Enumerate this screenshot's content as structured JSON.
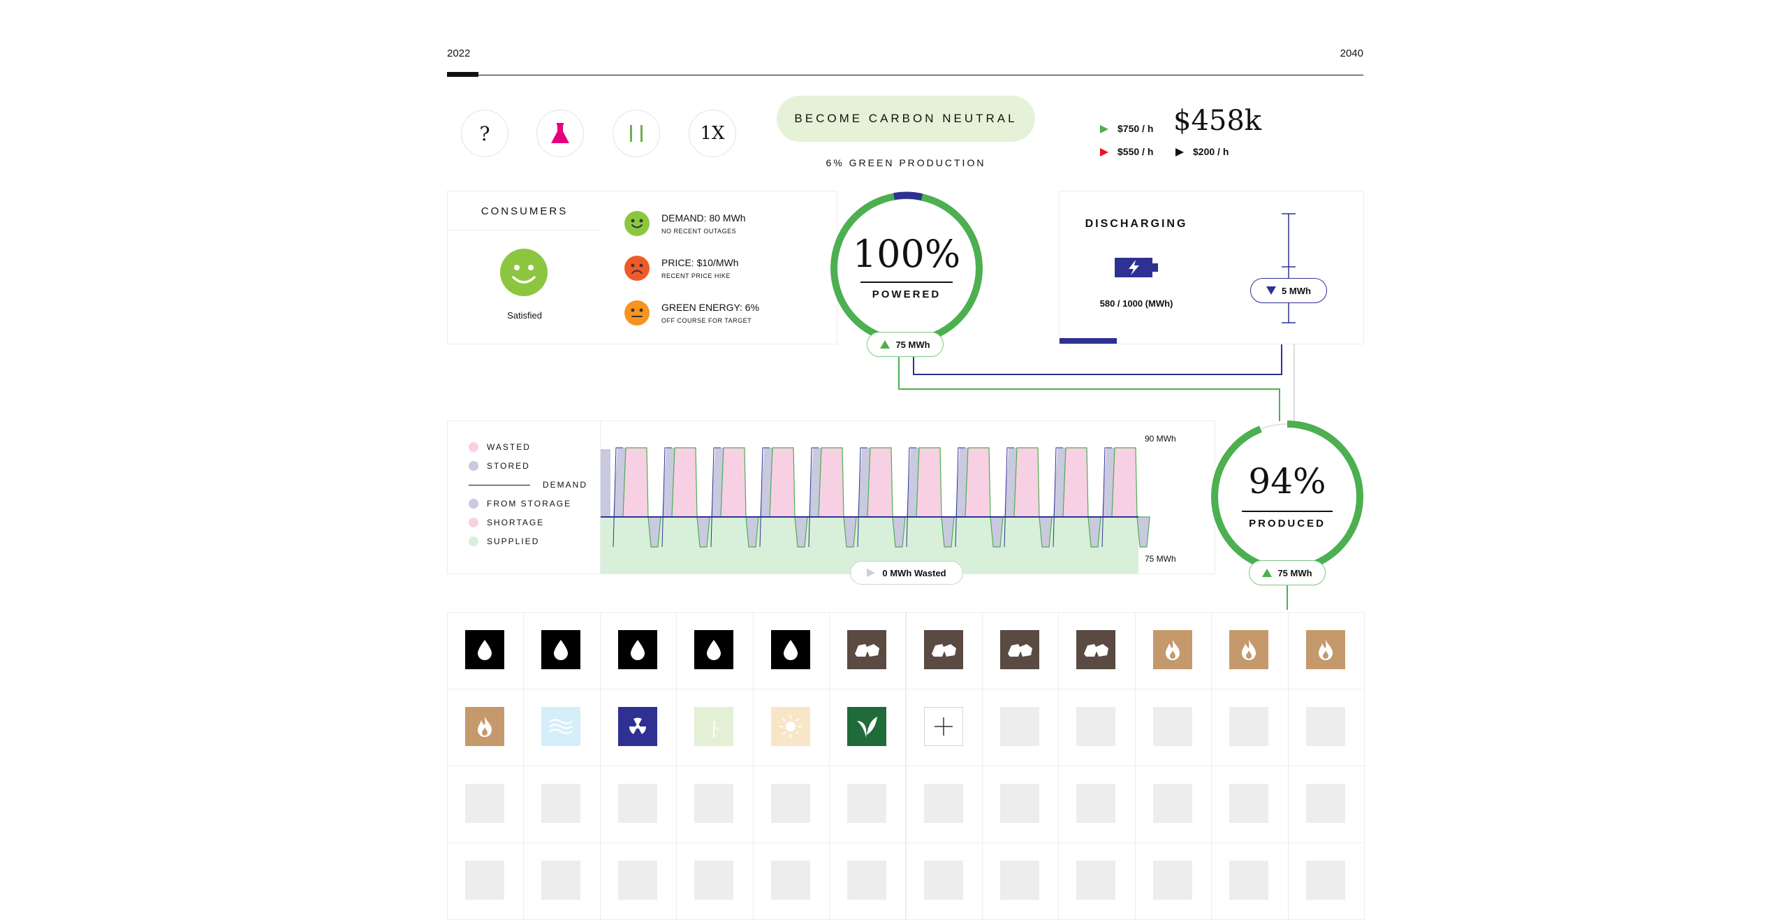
{
  "timeline": {
    "start_year": "2022",
    "end_year": "2040",
    "progress": 0.034
  },
  "controls": {
    "help_label": "?",
    "pause_label": "| |",
    "speed_label": "1X"
  },
  "goal": {
    "button_label": "BECOME CARBON NEUTRAL",
    "green_production": "6% GREEN PRODUCTION"
  },
  "finance": {
    "balance": "$458k",
    "income": "$750 / h",
    "expense": "$550 / h",
    "net": "$200 / h"
  },
  "consumers": {
    "title": "CONSUMERS",
    "mood": "Satisfied",
    "stats": [
      {
        "label": "DEMAND: 80 MWh",
        "sub": "NO RECENT OUTAGES",
        "mood": "happy",
        "color": "#8cc63f"
      },
      {
        "label": "PRICE: $10/MWh",
        "sub": "RECENT PRICE HIKE",
        "mood": "sad",
        "color": "#f05a28"
      },
      {
        "label": "GREEN ENERGY: 6%",
        "sub": "OFF COURSE FOR TARGET",
        "mood": "neutral",
        "color": "#f7941d"
      }
    ]
  },
  "powered": {
    "percent": "100%",
    "label": "POWERED",
    "value": 1.0,
    "flow": "75 MWh"
  },
  "storage": {
    "title": "DISCHARGING",
    "capacity": "580 / 1000 (MWh)",
    "level": 0.58,
    "flow": "5 MWh"
  },
  "chart": {
    "legend": [
      "WASTED",
      "STORED",
      "DEMAND",
      "FROM STORAGE",
      "SHORTAGE",
      "SUPPLIED"
    ],
    "top_label": "90 MWh",
    "bottom_label": "75 MWh",
    "wasted_label": "0 MWh Wasted",
    "cycles": 11
  },
  "produced": {
    "percent": "94%",
    "label": "PRODUCED",
    "value": 0.94,
    "flow": "75 MWh"
  },
  "colors": {
    "green": "#4caf50",
    "navy": "#2e3192",
    "wasted": "#f8d0e3",
    "stored": "#c9c9e0",
    "supplied": "#d8f0da",
    "hydro": "#000000",
    "coal": "#5a4a42",
    "gas": "#c49a6c",
    "nuclear": "#2e3192"
  },
  "grid": {
    "rows": [
      [
        "hydro",
        "hydro",
        "hydro",
        "hydro",
        "hydro",
        "coal",
        "coal",
        "coal",
        "coal",
        "gas",
        "gas",
        "gas"
      ],
      [
        "gas",
        "wave",
        "nuclear",
        "wind",
        "solar",
        "biomass",
        "add",
        "empty",
        "empty",
        "empty",
        "empty",
        "empty"
      ],
      [
        "empty",
        "empty",
        "empty",
        "empty",
        "empty",
        "empty",
        "empty",
        "empty",
        "empty",
        "empty",
        "empty",
        "empty"
      ],
      [
        "empty",
        "empty",
        "empty",
        "empty",
        "empty",
        "empty",
        "empty",
        "empty",
        "empty",
        "empty",
        "empty",
        "empty"
      ]
    ]
  }
}
